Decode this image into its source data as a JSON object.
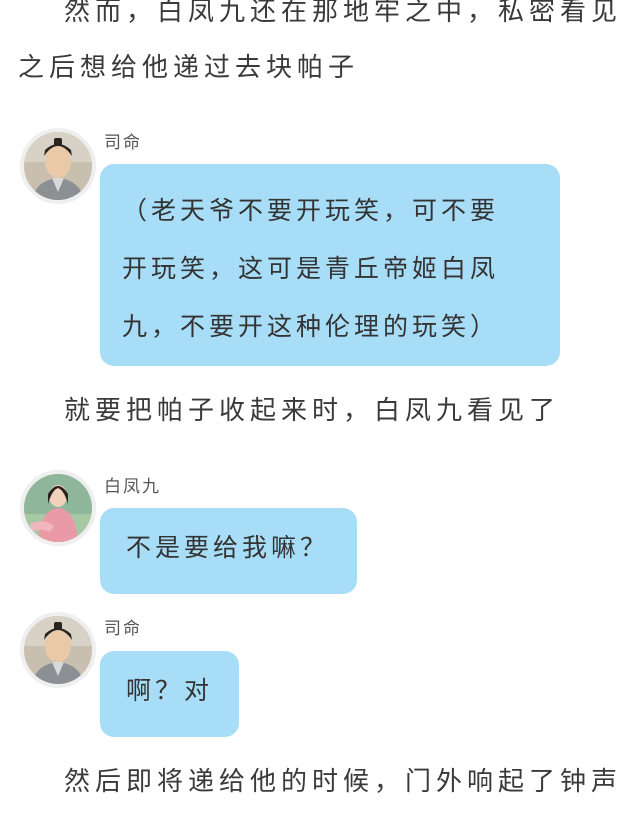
{
  "narration": {
    "line1": "然而，白凤九还在那地牢之中，私密看见",
    "line2": "之后想给他递过去块帕子",
    "line3": "就要把帕子收起来时，白凤九看见了",
    "line4": "然后即将递给他的时候，门外响起了钟声"
  },
  "messages": [
    {
      "speaker": "司命",
      "avatar_icon": "male-character-avatar",
      "lines": [
        "（老天爷不要开玩笑，可不要",
        "开玩笑，这可是青丘帝姬白凤",
        "九，不要开这种伦理的玩笑）"
      ]
    },
    {
      "speaker": "白凤九",
      "avatar_icon": "female-character-avatar",
      "lines": [
        "不是要给我嘛？"
      ]
    },
    {
      "speaker": "司命",
      "avatar_icon": "male-character-avatar",
      "lines": [
        "啊？对"
      ]
    }
  ],
  "colors": {
    "bubble": "#a8ddf7",
    "text": "#333333",
    "avatar_ring": "#efefef"
  }
}
